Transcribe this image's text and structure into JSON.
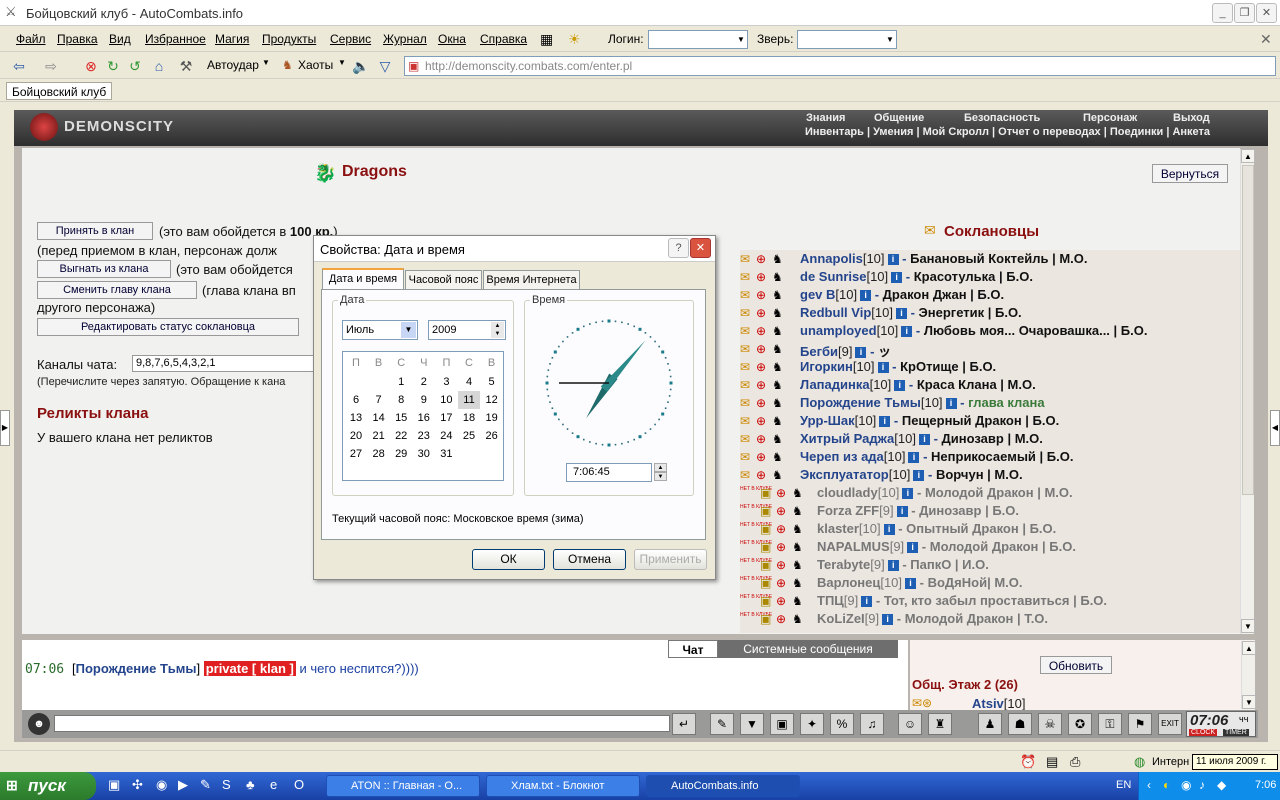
{
  "window": {
    "title": "Бойцовский клуб - AutoCombats.info"
  },
  "menu": {
    "items": [
      "Файл",
      "Правка",
      "Вид",
      "Избранное",
      "Магия",
      "Продукты",
      "Сервис",
      "Журнал",
      "Окна",
      "Справка"
    ],
    "login_label": "Логин:",
    "beast_label": "Зверь:"
  },
  "toolbar": {
    "autostrike": "Автоудар",
    "chaots": "Хаоты",
    "url": "http://demonscity.combats.com/enter.pl"
  },
  "links": {
    "tab": "Бойцовский клуб"
  },
  "game": {
    "logo": "DEMONSCITY",
    "nav_top": [
      "Знания",
      "Общение",
      "Безопасность",
      "Персонаж",
      "Выход"
    ],
    "nav_bottom": "Инвентарь | Умения | Мой Скролл | Отчет о переводах | Поединки | Анкета",
    "clan_name": "Dragons",
    "back_button": "Вернуться",
    "accept_button": "Принять в клан",
    "accept_note_1": "(это вам обойдется в",
    "accept_cost": "100 кр.",
    "accept_note_2": ")",
    "accept_note_line2": "(перед приемом в клан, персонаж долж",
    "kick_button": "Выгнать из клана",
    "kick_note": "(это вам обойдется",
    "change_head_button": "Сменить главу клана",
    "change_head_note": "(глава клана вп",
    "change_head_note_line2": "другого персонажа)",
    "edit_status_button": "Редактировать статус соклановца",
    "channels_label": "Каналы чата:",
    "channels_value": "9,8,7,6,5,4,3,2,1",
    "channels_note": "(Перечислите через запятую. Обращение к кана",
    "relics_title": "Реликты клана",
    "relics_text": "У вашего клана нет реликтов",
    "members_title": "Соклановцы"
  },
  "members": [
    {
      "name": "Annapolis",
      "level": "[10]",
      "title": "Банановый Коктейль | М.О.",
      "online": true
    },
    {
      "name": "de Sunrise",
      "level": "[10]",
      "title": "Красотулька | Б.О.",
      "online": true
    },
    {
      "name": "gev B",
      "level": "[10]",
      "title": "Дракон Джан | Б.О.",
      "online": true
    },
    {
      "name": "Redbull Vip",
      "level": "[10]",
      "title": "Энергетик | Б.О.",
      "online": true
    },
    {
      "name": "unamployed",
      "level": "[10]",
      "title": "Любовь моя... Очаровашка... | Б.О.",
      "online": true
    },
    {
      "name": "Бегби",
      "level": "[9]",
      "title": "ッ",
      "online": true
    },
    {
      "name": "Игоркин",
      "level": "[10]",
      "title": "КрОтище | Б.О.",
      "online": true
    },
    {
      "name": "Лападинка",
      "level": "[10]",
      "title": "Краса Клана | М.О.",
      "online": true
    },
    {
      "name": "Порождение Тьмы",
      "level": "[10]",
      "title": "глава клана",
      "online": true,
      "green": true
    },
    {
      "name": "Урр-Шак",
      "level": "[10]",
      "title": "Пещерный Дракон | Б.О.",
      "online": true
    },
    {
      "name": "Хитрый Раджа",
      "level": "[10]",
      "title": "Динозавр | М.О.",
      "online": true
    },
    {
      "name": "Череп из ада",
      "level": "[10]",
      "title": "Неприкосаемый | Б.О.",
      "online": true
    },
    {
      "name": "Эксплуататор",
      "level": "[10]",
      "title": "Ворчун | М.О.",
      "online": true
    },
    {
      "name": "cloudlady",
      "level": "[10]",
      "title": "Молодой Дракон | М.О.",
      "online": false
    },
    {
      "name": "Forza ZFF",
      "level": "[9]",
      "title": "Динозавр | Б.О.",
      "online": false
    },
    {
      "name": "klaster",
      "level": "[10]",
      "title": "Опытный Дракон | Б.О.",
      "online": false
    },
    {
      "name": "NAPALMUS",
      "level": "[9]",
      "title": "Молодой Дракон | Б.О.",
      "online": false
    },
    {
      "name": "Terabyte",
      "level": "[9]",
      "title": "ПапкО | И.О.",
      "online": false
    },
    {
      "name": "Варлонец",
      "level": "[10]",
      "title": "ВоДяНой| М.О.",
      "online": false
    },
    {
      "name": "ТПЦ",
      "level": "[9]",
      "title": "Тот, кто забыл проставиться | Б.О.",
      "online": false
    },
    {
      "name": "KoLiZeI",
      "level": "[9]",
      "title": "Молодой Дракон | Т.О.",
      "online": false
    }
  ],
  "offline_badge": "НЕТ В КЛУБЕ",
  "chat": {
    "tab_chat": "Чат",
    "tab_system": "Системные сообщения",
    "time": "07:06",
    "author": "Порождение Тьмы",
    "private": "private [ klan ]",
    "message": "и чего неспится?))))"
  },
  "right_panel": {
    "refresh": "Обновить",
    "floor": "Общ. Этаж 2 (26)",
    "first_user": "Atsiv",
    "first_level": "[10]"
  },
  "clock": {
    "time": "07:06",
    "unit": "чч",
    "clock": "CLOCK",
    "timer": "TIMER"
  },
  "dialog": {
    "title": "Свойства: Дата и время",
    "tabs": [
      "Дата и время",
      "Часовой пояс",
      "Время Интернета"
    ],
    "date_group": "Дата",
    "time_group": "Время",
    "month": "Июль",
    "year": "2009",
    "weekdays": [
      "П",
      "В",
      "С",
      "Ч",
      "П",
      "С",
      "В"
    ],
    "days": [
      "",
      "",
      "1",
      "2",
      "3",
      "4",
      "5",
      "6",
      "7",
      "8",
      "9",
      "10",
      "11",
      "12",
      "13",
      "14",
      "15",
      "16",
      "17",
      "18",
      "19",
      "20",
      "21",
      "22",
      "23",
      "24",
      "25",
      "26",
      "27",
      "28",
      "29",
      "30",
      "31"
    ],
    "selected_day": "11",
    "time_value": "7:06:45",
    "timezone": "Текущий часовой пояс: Московское время (зима)",
    "ok": "ОК",
    "cancel": "Отмена",
    "apply": "Применить",
    "clock_hour": 7,
    "clock_minute": 6,
    "clock_second": 45
  },
  "taskbar": {
    "start": "пуск",
    "tasks": [
      "ATON :: Главная - О...",
      "Хлам.txt - Блокнот",
      "AutoCombats.info"
    ],
    "lang": "EN",
    "time": "7:06",
    "tooltip": "11 июля 2009 г.",
    "status_text": "Интерн"
  },
  "colors": {
    "accent": "#8b1010",
    "link": "#24458c"
  }
}
